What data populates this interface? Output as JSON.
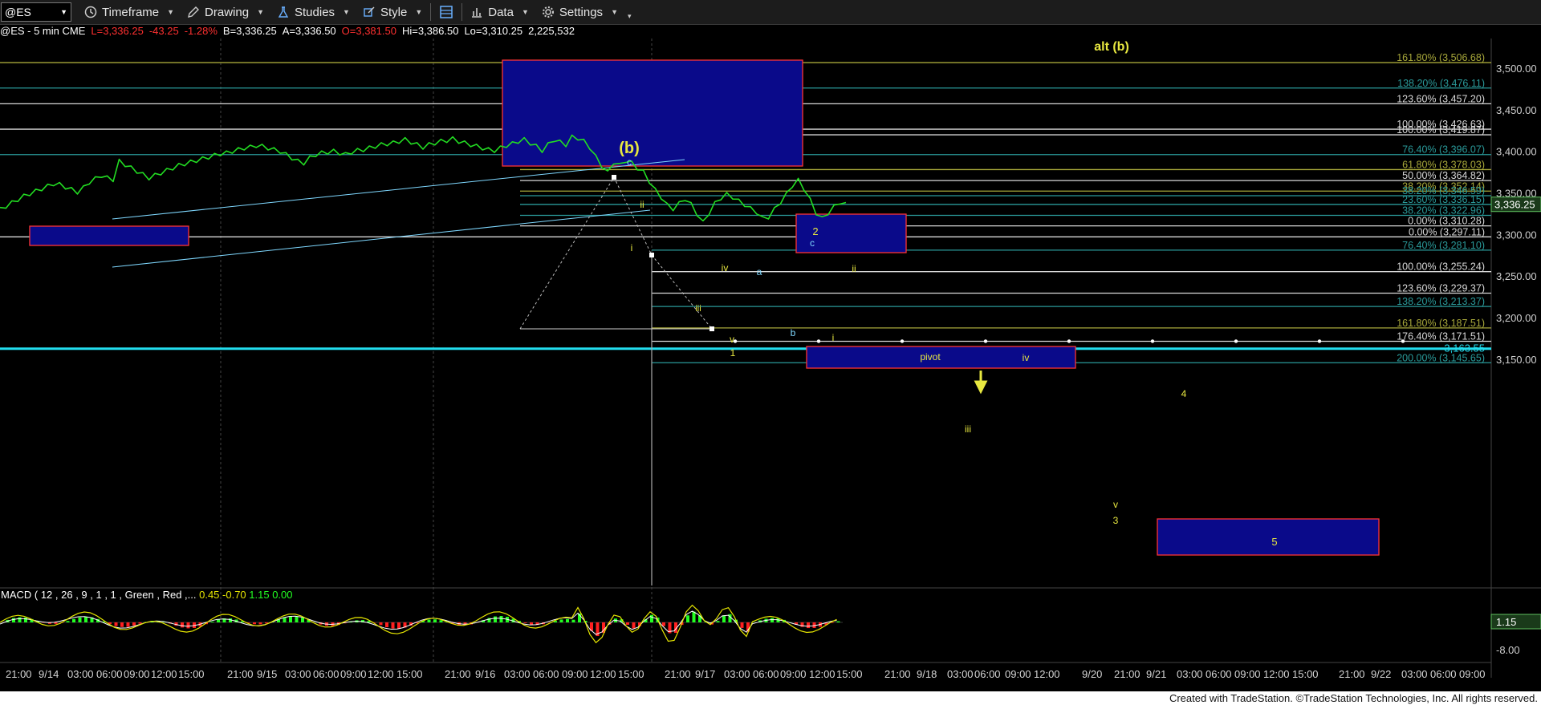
{
  "toolbar": {
    "symbol": "@ES",
    "timeframe": "Timeframe",
    "drawing": "Drawing",
    "studies": "Studies",
    "style": "Style",
    "data": "Data",
    "settings": "Settings"
  },
  "status": {
    "symbol": "@ES - 5 min CME",
    "last": "L=3,336.25",
    "change": "-43.25",
    "pct": "-1.28%",
    "bid": "B=3,336.25",
    "ask": "A=3,336.50",
    "open": "O=3,381.50",
    "high": "Hi=3,386.50",
    "low": "Lo=3,310.25",
    "volume": "2,225,532"
  },
  "colors": {
    "background": "#000000",
    "price": "#22dd22",
    "fib_white": "#d8d8d8",
    "fib_olive": "#a8a83a",
    "fib_teal": "#2a9a9a",
    "box_fill": "#0a0a8a",
    "box_border": "#ff3333",
    "label_yellow": "#e8e840",
    "label_cyan": "#7fd8ff",
    "cyan_line": "#22ddee",
    "macd_yellow": "#e6e600",
    "macd_red": "#ff2020",
    "macd_green": "#22ff22"
  },
  "footer": "Created with TradeStation. ©TradeStation Technologies, Inc. All rights reserved.",
  "chart_data": {
    "type": "line",
    "title": "@ES - 5 min CME",
    "ylim": [
      3120,
      3520
    ],
    "y_ticks": [
      "3,500.00",
      "3,450.00",
      "3,400.00",
      "3,350.00",
      "3,300.00",
      "3,250.00",
      "3,200.00",
      "3,150.00"
    ],
    "y_tick_values": [
      3500,
      3450,
      3400,
      3350,
      3300,
      3250,
      3200,
      3150
    ],
    "x_ticks": [
      "21:00",
      "9/14",
      "03:00",
      "06:00",
      "09:00",
      "12:00",
      "15:00",
      "21:00",
      "9/15",
      "03:00",
      "06:00",
      "09:00",
      "12:00",
      "15:00",
      "21:00",
      "9/16",
      "03:00",
      "06:00",
      "09:00",
      "12:00",
      "15:00",
      "21:00",
      "9/17",
      "03:00",
      "06:00",
      "09:00",
      "12:00",
      "15:00",
      "21:00",
      "9/18",
      "03:00",
      "06:00",
      "09:00",
      "12:00",
      "9/20",
      "21:00",
      "9/21",
      "03:00",
      "06:00",
      "09:00",
      "12:00",
      "15:00",
      "21:00",
      "9/22",
      "03:00",
      "06:00",
      "09:00"
    ],
    "series": [
      {
        "values": [
          3330,
          3334,
          3338,
          3342,
          3346,
          3349,
          3352,
          3355,
          3358,
          3361,
          3360,
          3357,
          3354,
          3351,
          3356,
          3363,
          3367,
          3371,
          3368,
          3366,
          3388,
          3384,
          3380,
          3376,
          3372,
          3368,
          3371,
          3374,
          3377,
          3380,
          3383,
          3385,
          3387,
          3389,
          3391,
          3393,
          3395,
          3397,
          3398,
          3400,
          3402,
          3404,
          3405,
          3407,
          3406,
          3404,
          3402,
          3400,
          3396,
          3392,
          3388,
          3386,
          3392,
          3396,
          3398,
          3399,
          3400,
          3398,
          3396,
          3399,
          3401,
          3402,
          3404,
          3406,
          3408,
          3409,
          3410,
          3412,
          3414,
          3411,
          3408,
          3405,
          3408,
          3410,
          3412,
          3413,
          3415,
          3412,
          3410,
          3408,
          3406,
          3404,
          3402,
          3401,
          3404,
          3407,
          3409,
          3412,
          3414,
          3410,
          3406,
          3401,
          3408,
          3414,
          3411,
          3408,
          3417,
          3416,
          3412,
          3405,
          3393,
          3383,
          3374,
          3387,
          3383,
          3389,
          3386,
          3380,
          3375,
          3364,
          3353,
          3345,
          3335,
          3331,
          3337,
          3343,
          3336,
          3325,
          3314,
          3326,
          3337,
          3344,
          3348,
          3345,
          3340,
          3336,
          3331,
          3327,
          3319,
          3321,
          3330,
          3339,
          3348,
          3359,
          3365,
          3355,
          3341,
          3326,
          3319,
          3326,
          3333,
          3339,
          3336
        ]
      }
    ],
    "fib_levels": [
      {
        "label": "161.80% (3,506.68)",
        "value": 3506.68,
        "color": "olive",
        "full": true
      },
      {
        "label": "138.20% (3,476.11)",
        "value": 3476.11,
        "color": "teal",
        "full": true
      },
      {
        "label": "123.60% (3,457.20)",
        "value": 3457.2,
        "color": "white",
        "full": true
      },
      {
        "label": "100.00% (3,426.63)",
        "value": 3426.63,
        "color": "white",
        "full": true
      },
      {
        "label": "100.00% (3,419.87)",
        "value": 3419.87,
        "color": "white",
        "full": false
      },
      {
        "label": "76.40% (3,396.07)",
        "value": 3396.07,
        "color": "teal",
        "full": true
      },
      {
        "label": "61.80% (3,378.03)",
        "value": 3378.03,
        "color": "olive",
        "full": false
      },
      {
        "label": "50.00% (3,364.82)",
        "value": 3364.82,
        "color": "white",
        "full": false
      },
      {
        "label": "38.20% (3,352.14)",
        "value": 3352.14,
        "color": "olive",
        "full": false
      },
      {
        "label": "38.20% (3,346.59)",
        "value": 3346.59,
        "color": "teal",
        "full": false
      },
      {
        "label": "23.60% (3,336.15)",
        "value": 3336.15,
        "color": "teal",
        "full": false
      },
      {
        "label": "38.20% (3,322.96)",
        "value": 3322.96,
        "color": "teal",
        "full": false
      },
      {
        "label": "0.00% (3,310.28)",
        "value": 3310.28,
        "color": "white",
        "full": false
      },
      {
        "label": "0.00% (3,297.11)",
        "value": 3297.11,
        "color": "white",
        "full": true
      },
      {
        "label": "76.40% (3,281.10)",
        "value": 3281.1,
        "color": "teal",
        "full": false
      },
      {
        "label": "100.00% (3,255.24)",
        "value": 3255.24,
        "color": "white",
        "full": false
      },
      {
        "label": "123.60% (3,229.37)",
        "value": 3229.37,
        "color": "white",
        "full": false
      },
      {
        "label": "138.20% (3,213.37)",
        "value": 3213.37,
        "color": "teal",
        "full": false
      },
      {
        "label": "161.80% (3,187.51)",
        "value": 3187.51,
        "color": "olive",
        "full": false
      },
      {
        "label": "176.40% (3,171.51)",
        "value": 3171.51,
        "color": "white",
        "full": false
      },
      {
        "label": "200.00% (3,145.65)",
        "value": 3145.65,
        "color": "teal",
        "full": false
      }
    ],
    "last_price_label": "3,336.25",
    "last_price": 3336.25,
    "cyan_line_label": "3,163.55",
    "cyan_line_value": 3163.55,
    "wave_labels": {
      "b_paren": "(b)",
      "alt_b": "alt (b)",
      "c_top": "c",
      "ii_top": "ii",
      "i_1": "i",
      "iii_1": "iii",
      "iv_1": "iv",
      "v_1": "v",
      "one": "1",
      "a": "a",
      "b": "b",
      "c": "c",
      "two": "2",
      "i_2": "i",
      "ii_2": "ii",
      "pivot": "pivot",
      "iv_target": "iv",
      "iii_target": "iii",
      "four": "4",
      "v_target": "v",
      "three": "3",
      "five": "5"
    },
    "macd": {
      "label": "MACD ( 12 , 26 , 9 , 1 , 1 , Green , Red ,...",
      "macd": "0.45",
      "signal": "-0.70",
      "diff": "1.15",
      "zero": "0.00",
      "axis_value_label": "1.15",
      "axis_low_label": "-8.00"
    }
  }
}
